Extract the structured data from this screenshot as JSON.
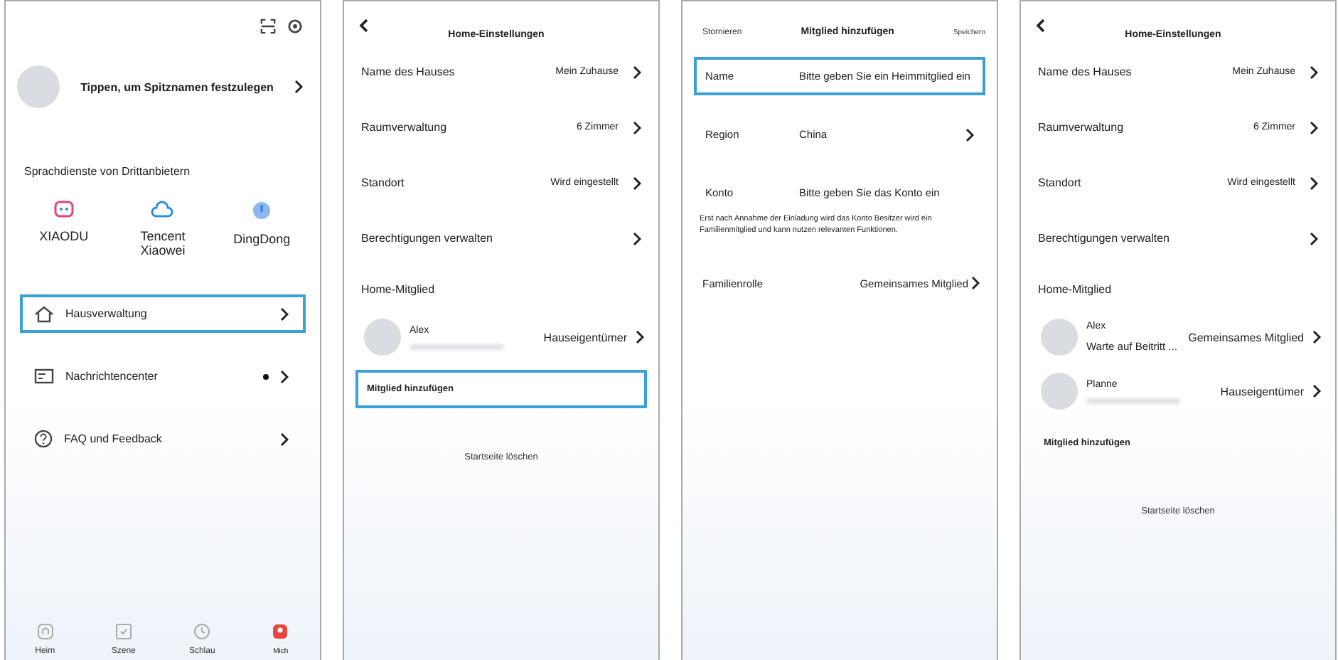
{
  "screens": [
    {
      "kind": "profile",
      "nickname": "Tippen, um Spitznamen festzulegen",
      "section_title": "Sprachdienste von Drittanbietern",
      "services": [
        {
          "label": "XIAODU",
          "kind": "robot"
        },
        {
          "label": "Tencent Xiaowei",
          "kind": "cloud"
        },
        {
          "label": "DingDong",
          "kind": "orb"
        }
      ],
      "menu": [
        {
          "label": "Hausverwaltung",
          "kind": "house",
          "highlighted": true,
          "badge": false
        },
        {
          "label": "Nachrichtencenter",
          "kind": "message",
          "highlighted": false,
          "badge": true
        },
        {
          "label": "FAQ und Feedback",
          "kind": "help",
          "highlighted": false,
          "badge": false
        }
      ],
      "nav": [
        {
          "label": "Heim",
          "kind": "home",
          "selected": false
        },
        {
          "label": "Szene",
          "kind": "scene",
          "selected": false
        },
        {
          "label": "Schlau",
          "kind": "smart",
          "selected": false
        },
        {
          "label": "Mich",
          "kind": "me",
          "selected": true
        }
      ]
    },
    {
      "kind": "home_settings",
      "title": "Home-Einstellungen",
      "settings": [
        {
          "label": "Name des Hauses",
          "value": "Mein Zuhause"
        },
        {
          "label": "Raumverwaltung",
          "value": "6 Zimmer"
        },
        {
          "label": "Standort",
          "value": "Wird eingestellt"
        },
        {
          "label": "Berechtigungen verwalten"
        }
      ],
      "members_title": "Home-Mitglied",
      "members": [
        {
          "name": "Alex",
          "role": "Hauseigentümer"
        }
      ],
      "add_label": "Mitglied hinzufügen",
      "add_highlighted": true,
      "delete_label": "Startseite löschen"
    },
    {
      "kind": "add_member",
      "cancel": "Stornieren",
      "title": "Mitglied hinzufügen",
      "save": "Speichern",
      "fields": [
        {
          "label": "Name",
          "placeholder": "Bitte geben Sie ein Heimmitglied ein",
          "highlighted": true,
          "chevron": false
        },
        {
          "label": "Region",
          "value": "China",
          "highlighted": false,
          "chevron": true
        },
        {
          "label": "Konto",
          "placeholder": "Bitte geben Sie das Konto ein",
          "highlighted": false,
          "chevron": false
        }
      ],
      "note": "Erst nach Annahme der Einladung wird das Konto Besitzer wird ein Familienmitglied und kann nutzen relevanten Funktionen.",
      "role": {
        "label": "Familienrolle",
        "value": "Gemeinsames Mitglied"
      }
    },
    {
      "kind": "home_settings",
      "title": "Home-Einstellungen",
      "settings": [
        {
          "label": "Name des Hauses",
          "value": "Mein Zuhause"
        },
        {
          "label": "Raumverwaltung",
          "value": "6 Zimmer"
        },
        {
          "label": "Standort",
          "value": "Wird eingestellt"
        },
        {
          "label": "Berechtigungen verwalten"
        }
      ],
      "members_title": "Home-Mitglied",
      "members": [
        {
          "name": "Alex",
          "status": "Warte auf Beitritt ...",
          "role": "Gemeinsames Mitglied"
        },
        {
          "name": "Planne",
          "role": "Hauseigentümer"
        }
      ],
      "add_label": "Mitglied hinzufügen",
      "add_highlighted": false,
      "delete_label": "Startseite löschen"
    }
  ]
}
